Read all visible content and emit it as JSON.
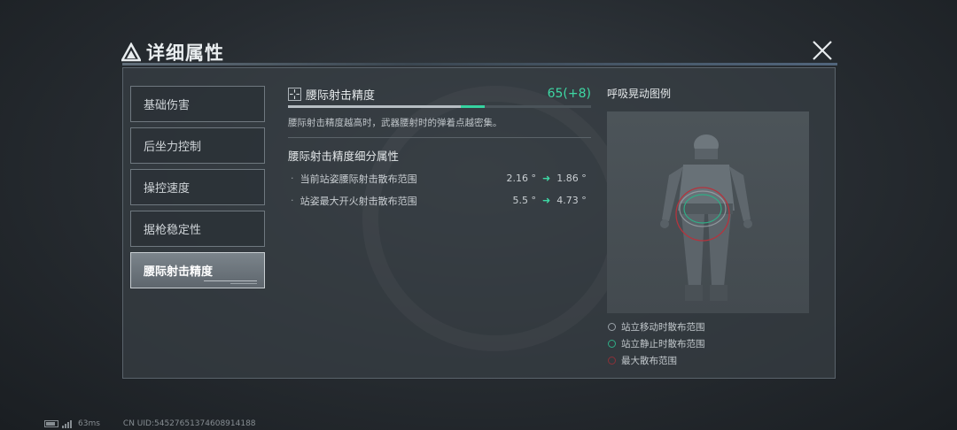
{
  "header": {
    "title": "详细属性"
  },
  "sidebar": {
    "items": [
      {
        "label": "基础伤害"
      },
      {
        "label": "后坐力控制"
      },
      {
        "label": "操控速度"
      },
      {
        "label": "据枪稳定性"
      },
      {
        "label": "腰际射击精度"
      }
    ],
    "active_index": 4
  },
  "stat": {
    "icon": "crosshair-icon",
    "name": "腰际射击精度",
    "value": "65(+8)",
    "progress_base": 0.57,
    "progress_bonus": 0.08,
    "description": "腰际射击精度越高时，武器腰射时的弹着点越密集。"
  },
  "sub_section": {
    "title": "腰际射击精度细分属性",
    "rows": [
      {
        "label": "当前站姿腰际射击散布范围",
        "old": "2.16 °",
        "new": "1.86 °"
      },
      {
        "label": "站姿最大开火射击散布范围",
        "old": "5.5 °",
        "new": "4.73 °"
      }
    ]
  },
  "preview": {
    "title": "呼吸晃动图例",
    "legend": [
      {
        "label": "站立移动时散布范围",
        "color": "#9aa2a8"
      },
      {
        "label": "站立静止时散布范围",
        "color": "#2fae86"
      },
      {
        "label": "最大散布范围",
        "color": "#8c3038"
      }
    ]
  },
  "footer": {
    "ping": "63ms",
    "uid": "CN UID:54527651374608914188"
  },
  "colors": {
    "accent": "#3ed8a4",
    "max_ring": "#b5333d"
  }
}
